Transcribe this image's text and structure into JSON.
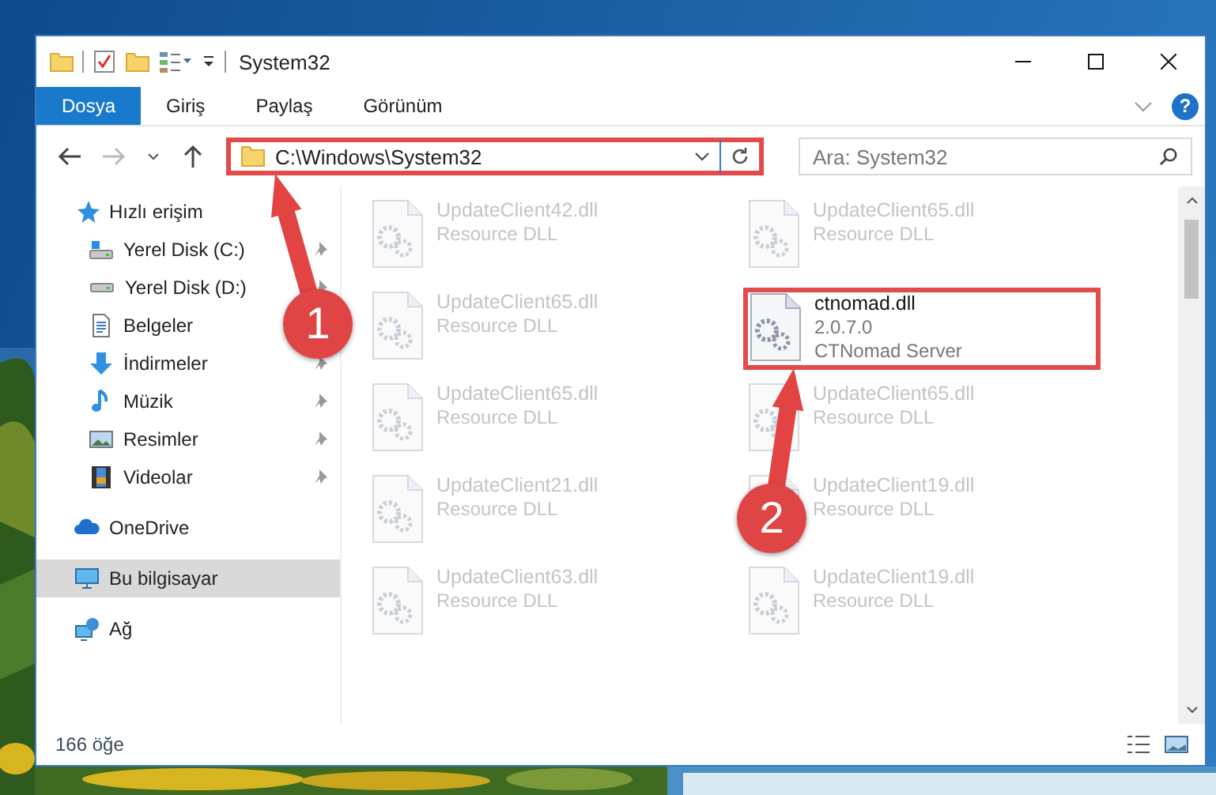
{
  "window": {
    "title": "System32"
  },
  "ribbon": {
    "tabs": [
      {
        "label": "Dosya",
        "selected": true
      },
      {
        "label": "Giriş",
        "selected": false
      },
      {
        "label": "Paylaş",
        "selected": false
      },
      {
        "label": "Görünüm",
        "selected": false
      }
    ],
    "help": "?"
  },
  "address": {
    "path": "C:\\Windows\\System32",
    "annotated": true
  },
  "search": {
    "placeholder": "Ara: System32"
  },
  "nav": [
    {
      "label": "Hızlı erişim",
      "kind": "quick",
      "selected": false,
      "children": [
        {
          "label": "Yerel Disk (C:)",
          "kind": "disk-c",
          "pinned": true
        },
        {
          "label": "Yerel Disk (D:)",
          "kind": "disk",
          "pinned": true
        },
        {
          "label": "Belgeler",
          "kind": "docs"
        },
        {
          "label": "İndirmeler",
          "kind": "download",
          "pinned": true
        },
        {
          "label": "Müzik",
          "kind": "music",
          "pinned": true
        },
        {
          "label": "Resimler",
          "kind": "pictures",
          "pinned": true
        },
        {
          "label": "Videolar",
          "kind": "videos",
          "pinned": true
        }
      ]
    },
    {
      "label": "OneDrive",
      "kind": "cloud",
      "selected": false
    },
    {
      "label": "Bu bilgisayar",
      "kind": "pc",
      "selected": true
    },
    {
      "label": "Ağ",
      "kind": "network",
      "selected": false
    }
  ],
  "files": [
    {
      "name": "UpdateClient42.dll",
      "details": [
        "Resource DLL"
      ],
      "blurred": true,
      "annotated": false
    },
    {
      "name": "UpdateClient65.dll",
      "details": [
        "Resource DLL"
      ],
      "blurred": true,
      "annotated": false
    },
    {
      "name": "UpdateClient65.dll",
      "details": [
        "Resource DLL"
      ],
      "blurred": true,
      "annotated": false
    },
    {
      "name": "ctnomad.dll",
      "details": [
        "2.0.7.0",
        "CTNomad Server"
      ],
      "blurred": false,
      "annotated": true
    },
    {
      "name": "UpdateClient65.dll",
      "details": [
        "Resource DLL"
      ],
      "blurred": true,
      "annotated": false
    },
    {
      "name": "UpdateClient65.dll",
      "details": [
        "Resource DLL"
      ],
      "blurred": true,
      "annotated": false
    },
    {
      "name": "UpdateClient21.dll",
      "details": [
        "Resource DLL"
      ],
      "blurred": true,
      "annotated": false
    },
    {
      "name": "UpdateClient19.dll",
      "details": [
        "Resource DLL"
      ],
      "blurred": true,
      "annotated": false
    },
    {
      "name": "UpdateClient63.dll",
      "details": [
        "Resource DLL"
      ],
      "blurred": true,
      "annotated": false
    },
    {
      "name": "UpdateClient19.dll",
      "details": [
        "Resource DLL"
      ],
      "blurred": true,
      "annotated": false
    }
  ],
  "status_bar": {
    "count": "166 öğe"
  },
  "annotations": [
    {
      "number": "1"
    },
    {
      "number": "2"
    }
  ]
}
